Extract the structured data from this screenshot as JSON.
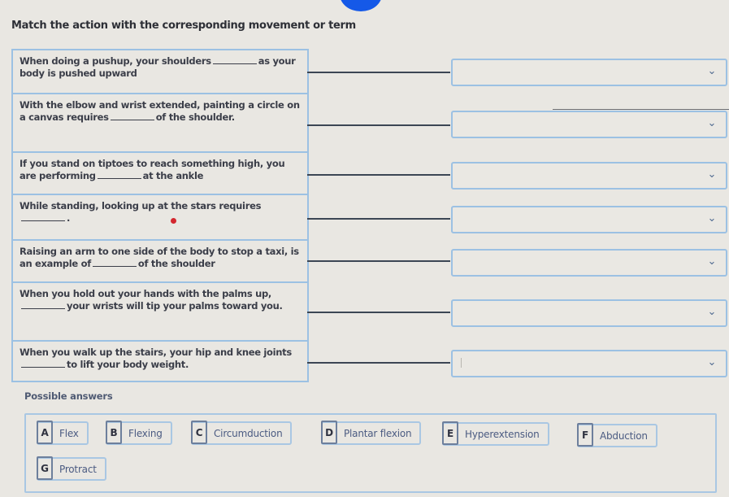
{
  "title": "Match the action with the corresponding movement or term",
  "prompts": [
    {
      "before": "When doing a pushup, your shoulders",
      "after": "as your body is pushed upward"
    },
    {
      "before": "With the elbow and wrist extended, painting a circle on a canvas requires",
      "after": "of the shoulder."
    },
    {
      "before": "If you stand on tiptoes to reach something high, you are performing",
      "after": "at the ankle"
    },
    {
      "before": "While standing, looking up at the stars requires",
      "after": "."
    },
    {
      "before": "Raising an arm to one side of the body to stop a taxi, is an example of",
      "after": "of the shoulder"
    },
    {
      "before": "When you hold out your hands with the palms up,",
      "after": "your wrists will tip your palms toward you."
    },
    {
      "before": "When you walk up the stairs, your hip and knee joints",
      "after": "to lift your body weight."
    }
  ],
  "selects": [
    {
      "value": ""
    },
    {
      "value": ""
    },
    {
      "value": ""
    },
    {
      "value": ""
    },
    {
      "value": ""
    },
    {
      "value": ""
    },
    {
      "value": ""
    }
  ],
  "chevron_icon": "⌄",
  "answers_label": "Possible answers",
  "answers": [
    {
      "letter": "A",
      "text": "Flex"
    },
    {
      "letter": "B",
      "text": "Flexing"
    },
    {
      "letter": "C",
      "text": "Circumduction"
    },
    {
      "letter": "D",
      "text": "Plantar flexion"
    },
    {
      "letter": "E",
      "text": "Hyperextension"
    },
    {
      "letter": "F",
      "text": "Abduction"
    },
    {
      "letter": "G",
      "text": "Protract"
    }
  ]
}
